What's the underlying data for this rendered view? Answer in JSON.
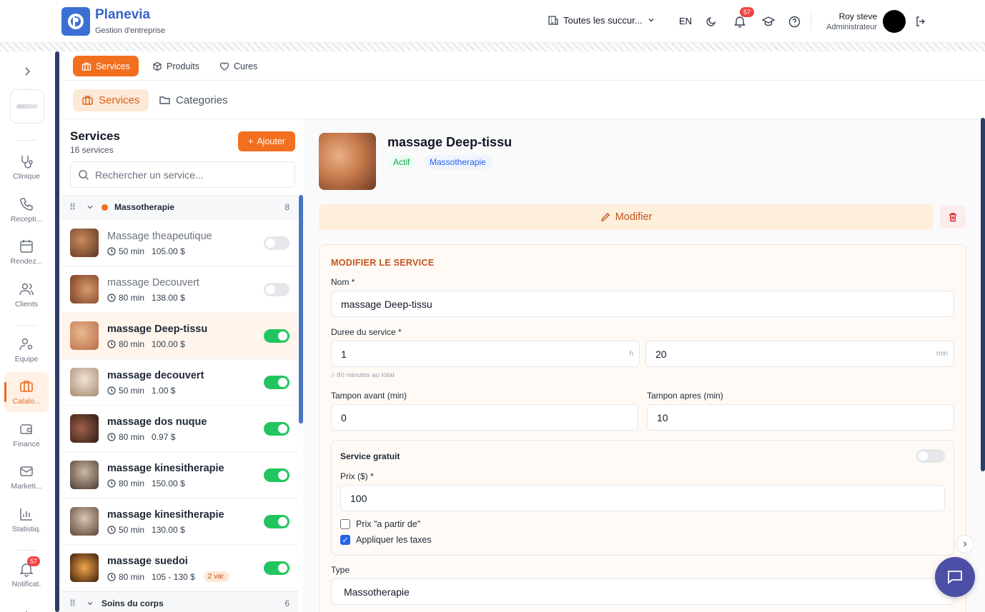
{
  "header": {
    "brand": "Planevia",
    "subtitle": "Gestion d'entreprise",
    "branch_label": "Toutes les succur...",
    "lang": "EN",
    "notifications_count": "57",
    "user_name": "Roy steve",
    "user_role": "Administrateur"
  },
  "rail": {
    "items": [
      {
        "label": "Clinique",
        "icon": "stethoscope-icon"
      },
      {
        "label": "Recepti...",
        "icon": "phone-icon"
      },
      {
        "label": "Rendez...",
        "icon": "calendar-icon"
      },
      {
        "label": "Clients",
        "icon": "users-icon"
      },
      {
        "label": "Equipe",
        "icon": "user-cog-icon"
      },
      {
        "label": "Catalo...",
        "icon": "briefcase-icon",
        "active": true
      },
      {
        "label": "Finance",
        "icon": "wallet-icon"
      },
      {
        "label": "Marketi...",
        "icon": "mail-icon"
      },
      {
        "label": "Statistiq.",
        "icon": "bar-chart-icon"
      },
      {
        "label": "Notificat.",
        "icon": "bell-icon",
        "badge": "57"
      }
    ]
  },
  "tabs_top": [
    "Services",
    "Produits",
    "Cures"
  ],
  "tabs_sub": [
    "Services",
    "Categories"
  ],
  "list": {
    "title": "Services",
    "count": "16 services",
    "add_label": "Ajouter",
    "search_placeholder": "Rechercher un service...",
    "categories": [
      {
        "name": "Massotherapie",
        "count": "8"
      },
      {
        "name": "Soins du corps",
        "count": "6"
      }
    ],
    "services": [
      {
        "name": "Massage theapeutique",
        "duration": "50 min",
        "price": "105.00 $",
        "active": false
      },
      {
        "name": "massage Decouvert",
        "duration": "80 min",
        "price": "138.00 $",
        "active": false
      },
      {
        "name": "massage Deep-tissu",
        "duration": "80 min",
        "price": "100.00 $",
        "active": true,
        "selected": true
      },
      {
        "name": "massage decouvert",
        "duration": "50 min",
        "price": "1.00 $",
        "active": true
      },
      {
        "name": "massage dos nuque",
        "duration": "80 min",
        "price": "0.97 $",
        "active": true
      },
      {
        "name": "massage kinesitherapie",
        "duration": "80 min",
        "price": "150.00 $",
        "active": true
      },
      {
        "name": "massage kinesitherapie",
        "duration": "50 min",
        "price": "130.00 $",
        "active": true
      },
      {
        "name": "massage suedoi",
        "duration": "80 min",
        "price": "105 - 130 $",
        "active": true,
        "variants": "2 var."
      }
    ]
  },
  "detail": {
    "title": "massage Deep-tissu",
    "status": "Actif",
    "type_badge": "Massotherapie",
    "modify_label": "Modifier",
    "form": {
      "section_title": "MODIFIER LE SERVICE",
      "name_label": "Nom *",
      "name_value": "massage Deep-tissu",
      "duration_label": "Duree du service *",
      "hours_value": "1",
      "hours_suffix": "h",
      "minutes_value": "20",
      "minutes_suffix": "min",
      "duration_hint": "= 80 minutes au total",
      "buffer_before_label": "Tampon avant (min)",
      "buffer_before_value": "0",
      "buffer_after_label": "Tampon apres (min)",
      "buffer_after_value": "10",
      "free_label": "Service gratuit",
      "price_label": "Prix ($) *",
      "price_value": "100",
      "from_price_label": "Prix \"a partir de\"",
      "taxes_label": "Appliquer les taxes",
      "type_label": "Type",
      "type_value": "Massotherapie"
    }
  },
  "colors": {
    "accent": "#f26f1f",
    "brand": "#3763c6",
    "toggle_on": "#22c55e"
  }
}
